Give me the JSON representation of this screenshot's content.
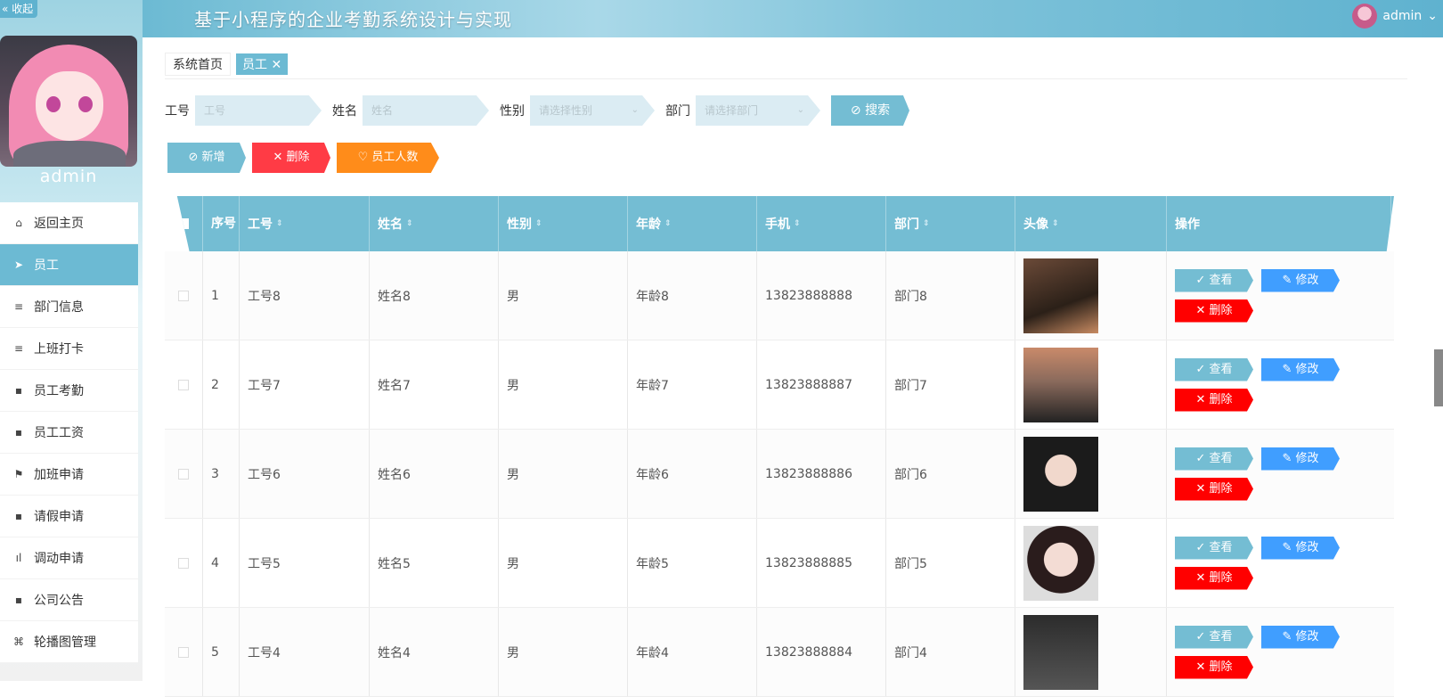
{
  "header": {
    "title": "基于小程序的企业考勤系统设计与实现",
    "user": "admin",
    "user_caret": "⌄"
  },
  "sidebar": {
    "collapse": "« 收起",
    "profile_name": "admin",
    "items": [
      {
        "icon": "⌂",
        "label": "返回主页"
      },
      {
        "icon": "➤",
        "label": "员工"
      },
      {
        "icon": "≡",
        "label": "部门信息"
      },
      {
        "icon": "≡",
        "label": "上班打卡"
      },
      {
        "icon": "▪",
        "label": "员工考勤"
      },
      {
        "icon": "▪",
        "label": "员工工资"
      },
      {
        "icon": "⚑",
        "label": "加班申请"
      },
      {
        "icon": "▪",
        "label": "请假申请"
      },
      {
        "icon": "ıl",
        "label": "调动申请"
      },
      {
        "icon": "▪",
        "label": "公司公告"
      },
      {
        "icon": "⌘",
        "label": "轮播图管理"
      }
    ]
  },
  "breadcrumb": {
    "home": "系统首页",
    "current": "员工 ✕"
  },
  "search": {
    "id_label": "工号",
    "id_placeholder": "工号",
    "name_label": "姓名",
    "name_placeholder": "姓名",
    "sex_label": "性别",
    "sex_placeholder": "请选择性别",
    "dept_label": "部门",
    "dept_placeholder": "请选择部门",
    "button": "⊘ 搜索"
  },
  "actions": {
    "add": "⊘ 新增",
    "delete": "✕ 删除",
    "count": "♡ 员工人数"
  },
  "table": {
    "headers": {
      "no": "序号",
      "id": "工号",
      "name": "姓名",
      "sex": "性别",
      "age": "年龄",
      "phone": "手机",
      "dept": "部门",
      "avatar": "头像",
      "ops": "操作"
    },
    "sort_icon": "⇕",
    "rows": [
      {
        "no": "1",
        "id": "工号8",
        "name": "姓名8",
        "sex": "男",
        "age": "年龄8",
        "phone": "13823888888",
        "dept": "部门8"
      },
      {
        "no": "2",
        "id": "工号7",
        "name": "姓名7",
        "sex": "男",
        "age": "年龄7",
        "phone": "13823888887",
        "dept": "部门7"
      },
      {
        "no": "3",
        "id": "工号6",
        "name": "姓名6",
        "sex": "男",
        "age": "年龄6",
        "phone": "13823888886",
        "dept": "部门6"
      },
      {
        "no": "4",
        "id": "工号5",
        "name": "姓名5",
        "sex": "男",
        "age": "年龄5",
        "phone": "13823888885",
        "dept": "部门5"
      },
      {
        "no": "5",
        "id": "工号4",
        "name": "姓名4",
        "sex": "男",
        "age": "年龄4",
        "phone": "13823888884",
        "dept": "部门4"
      }
    ],
    "ops": {
      "view": "✓ 查看",
      "edit": "✎ 修改",
      "delete": "✕ 删除"
    }
  },
  "colors": {
    "accent": "#74bdd3",
    "danger": "#ff3b45",
    "warning": "#ff8c1a",
    "primary": "#409eff"
  }
}
